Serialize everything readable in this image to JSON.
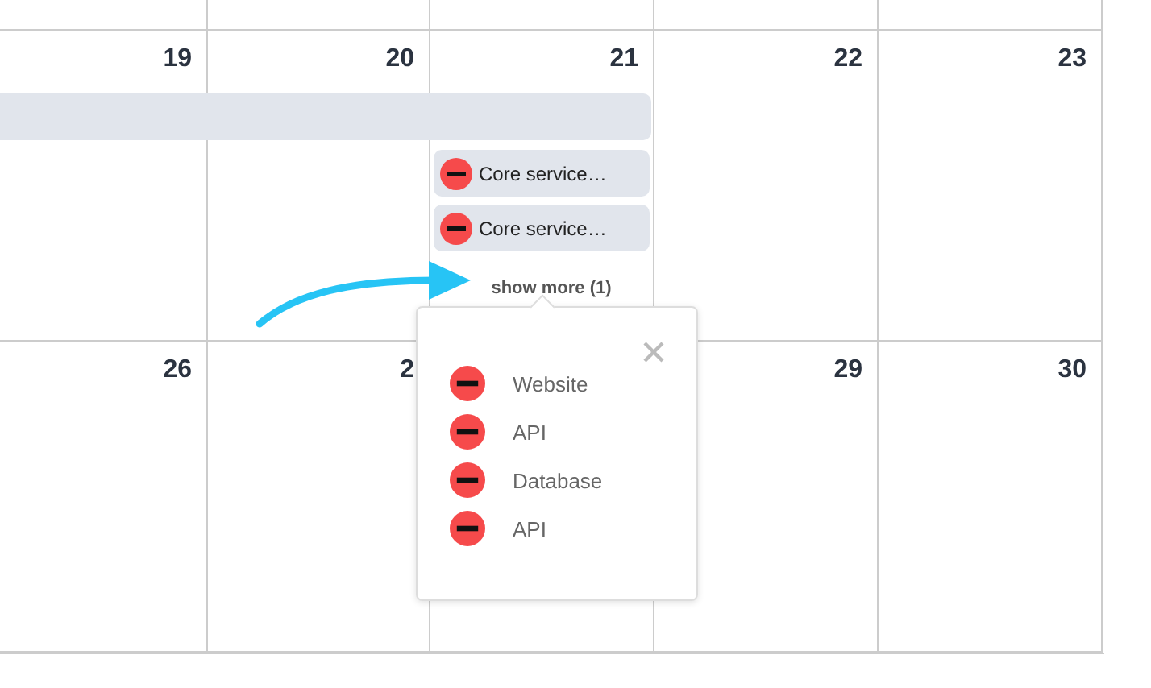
{
  "weeks": [
    {
      "days": [
        {
          "date": "19",
          "in_bar": true
        },
        {
          "date": "20",
          "in_bar": true
        },
        {
          "date": "21",
          "in_bar": true,
          "events": [
            {
              "title": "Core service…",
              "color": "#f64a4b"
            },
            {
              "title": "Core service…",
              "color": "#f64a4b"
            }
          ],
          "show_more": "show more (1)"
        },
        {
          "date": "22",
          "in_bar": false
        },
        {
          "date": "23",
          "in_bar": false
        }
      ]
    },
    {
      "days": [
        {
          "date": "26",
          "in_bar": false
        },
        {
          "date": "2",
          "in_bar": false
        },
        {
          "in_bar": false
        },
        {
          "date": "29",
          "in_bar": false
        },
        {
          "date": "30",
          "in_bar": false
        }
      ]
    }
  ],
  "popover": {
    "items": [
      {
        "label": "Website",
        "color": "#f64a4b"
      },
      {
        "label": "API",
        "color": "#f64a4b"
      },
      {
        "label": "Database",
        "color": "#f64a4b"
      },
      {
        "label": "API",
        "color": "#f64a4b"
      }
    ]
  },
  "pointer_arrow": true
}
